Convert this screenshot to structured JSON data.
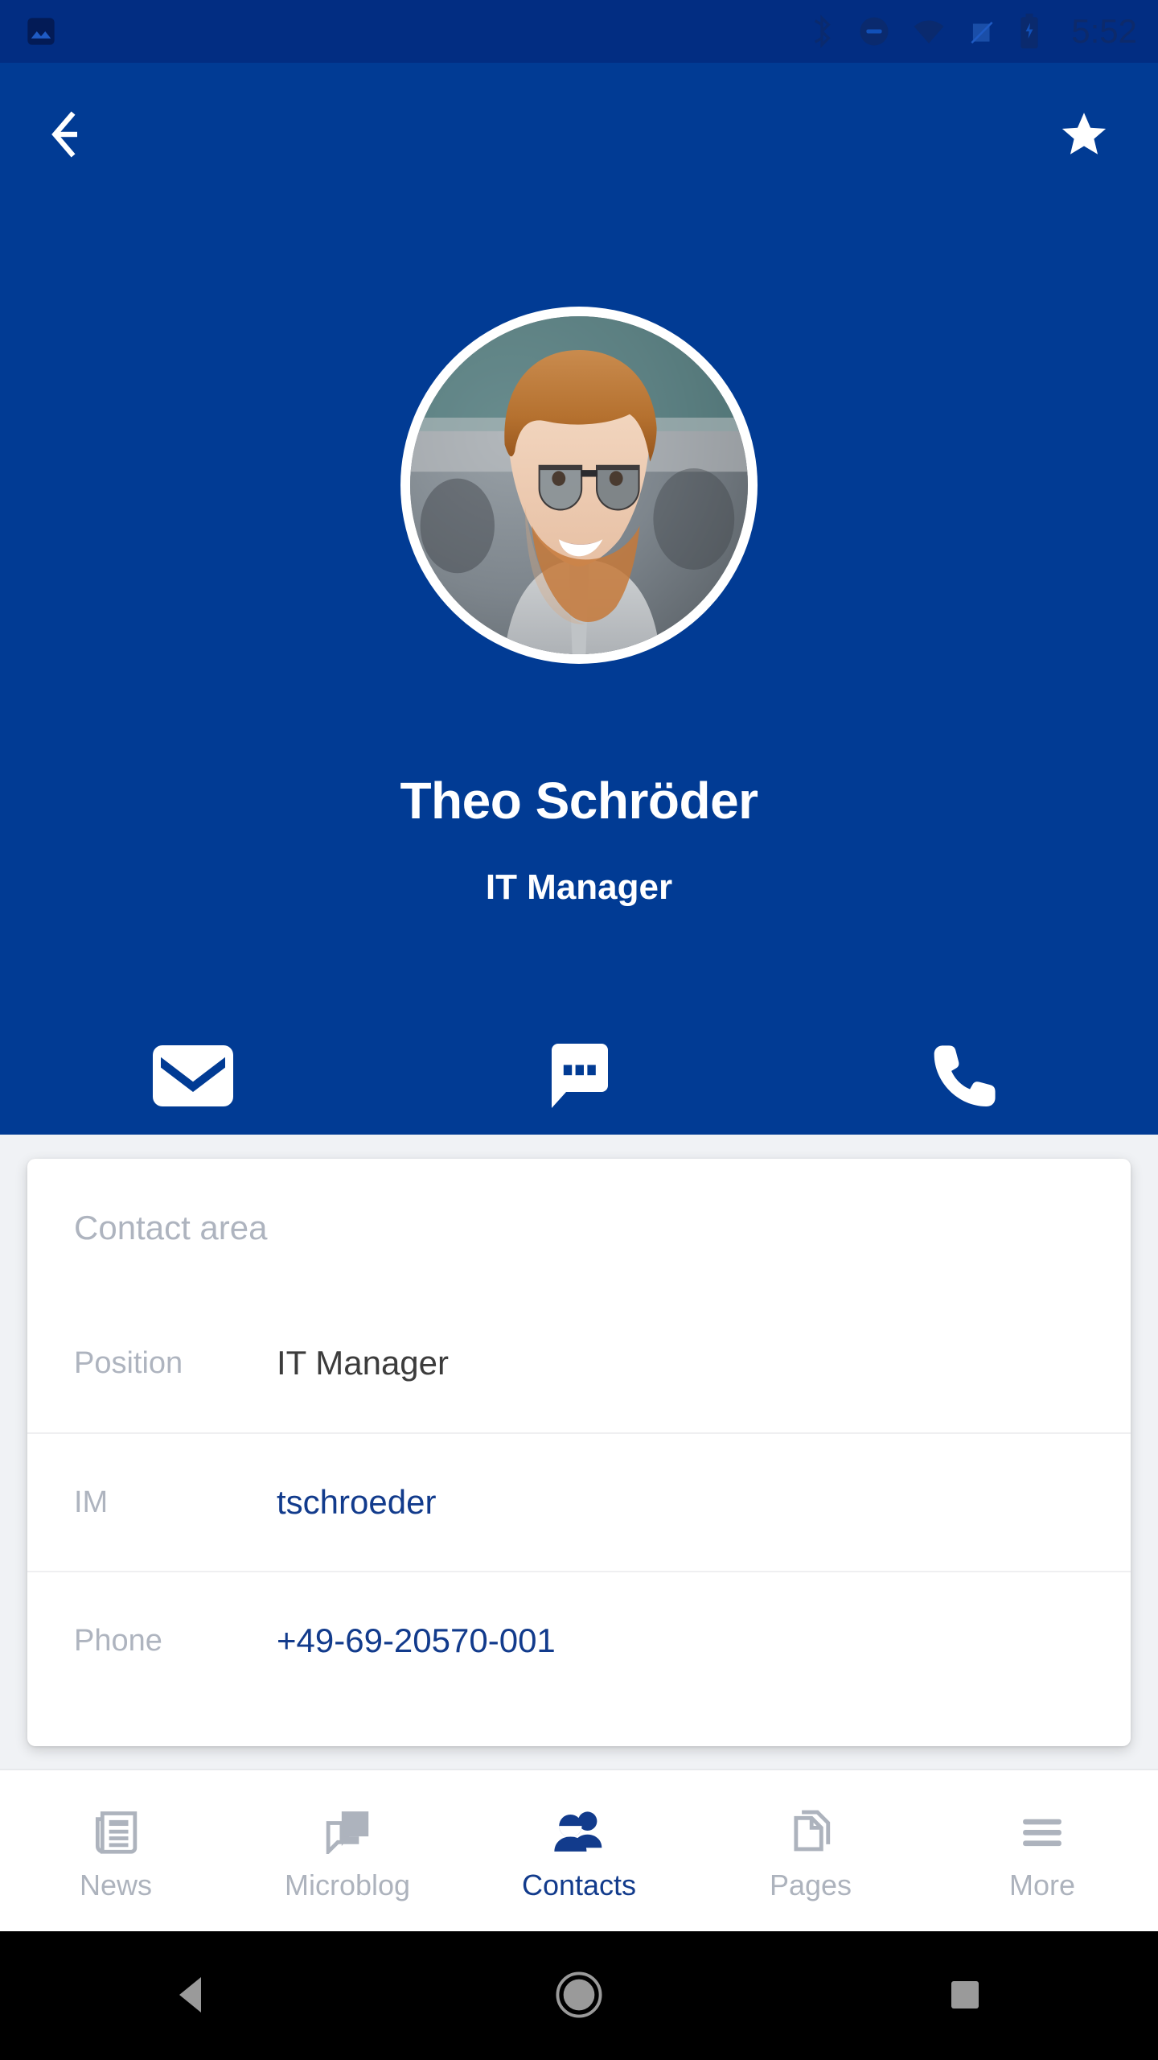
{
  "statusbar": {
    "time": "5:52",
    "icons_left": [
      "image-icon"
    ],
    "icons_right": [
      "bluetooth-icon",
      "do-not-disturb-icon",
      "wifi-icon",
      "signal-off-icon",
      "battery-charging-icon"
    ],
    "background_color": "#022D82"
  },
  "header": {
    "background_color": "#013B94",
    "back_label": "Back",
    "favorite_label": "Favorite",
    "person": {
      "name": "Theo Schröder",
      "title": "IT Manager",
      "avatar_alt": "Theo Schröder portrait"
    },
    "actions": [
      {
        "name": "email-action",
        "icon": "envelope-icon",
        "label": "Email"
      },
      {
        "name": "message-action",
        "icon": "chat-bubble-icon",
        "label": "Message"
      },
      {
        "name": "call-action",
        "icon": "phone-icon",
        "label": "Call"
      }
    ]
  },
  "card": {
    "title": "Contact area",
    "rows": [
      {
        "label": "Position",
        "value": "IT Manager",
        "style": "plain"
      },
      {
        "label": "IM",
        "value": "tschroeder",
        "style": "link"
      },
      {
        "label": "Phone",
        "value": "+49-69-20570-001",
        "style": "link"
      }
    ]
  },
  "tabbar": {
    "active_color": "#123B8C",
    "inactive_color": "#ADB3BD",
    "tabs": [
      {
        "label": "News",
        "icon": "newspaper-icon",
        "active": false
      },
      {
        "label": "Microblog",
        "icon": "chat-bubbles-icon",
        "active": false
      },
      {
        "label": "Contacts",
        "icon": "people-icon",
        "active": true
      },
      {
        "label": "Pages",
        "icon": "document-icon",
        "active": false
      },
      {
        "label": "More",
        "icon": "hamburger-icon",
        "active": false
      }
    ]
  },
  "navbar": {
    "buttons": [
      {
        "name": "android-back",
        "icon": "triangle-back-icon"
      },
      {
        "name": "android-home",
        "icon": "circle-home-icon"
      },
      {
        "name": "android-recents",
        "icon": "square-recents-icon"
      }
    ]
  }
}
